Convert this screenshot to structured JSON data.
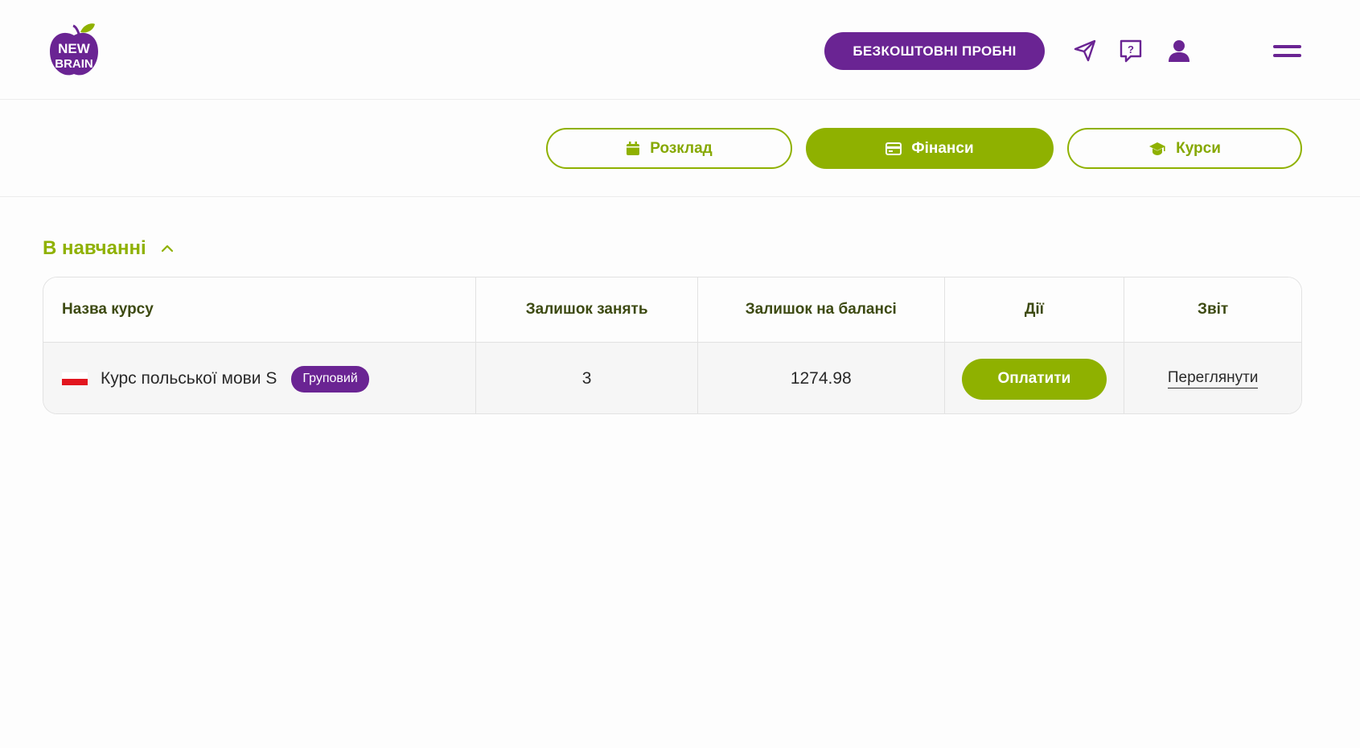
{
  "header": {
    "logo_alt": "NEW BRAIN",
    "trial_button": "БЕЗКОШТОВНІ  ПРОБНІ",
    "icons": [
      "send-icon",
      "help-chat-icon",
      "user-icon",
      "menu-icon"
    ]
  },
  "tabs": [
    {
      "label": "Розклад",
      "icon": "calendar-icon",
      "active": false
    },
    {
      "label": "Фінанси",
      "icon": "wallet-icon",
      "active": true
    },
    {
      "label": "Курси",
      "icon": "graduation-cap-icon",
      "active": false
    }
  ],
  "section": {
    "title": "В навчанні",
    "expanded": true
  },
  "table": {
    "headers": [
      "Назва курсу",
      "Залишок занять",
      "Залишок на балансі",
      "Дії",
      "Звіт"
    ],
    "rows": [
      {
        "flag": "poland-flag-icon",
        "course": "Курс польської мови S",
        "badge": "Груповий",
        "lessons_left": "3",
        "balance": "1274.98",
        "action": "Оплатити",
        "report": "Переглянути"
      }
    ]
  },
  "colors": {
    "purple": "#6a2493",
    "green": "#8fb100",
    "border": "#e2e2e2"
  }
}
